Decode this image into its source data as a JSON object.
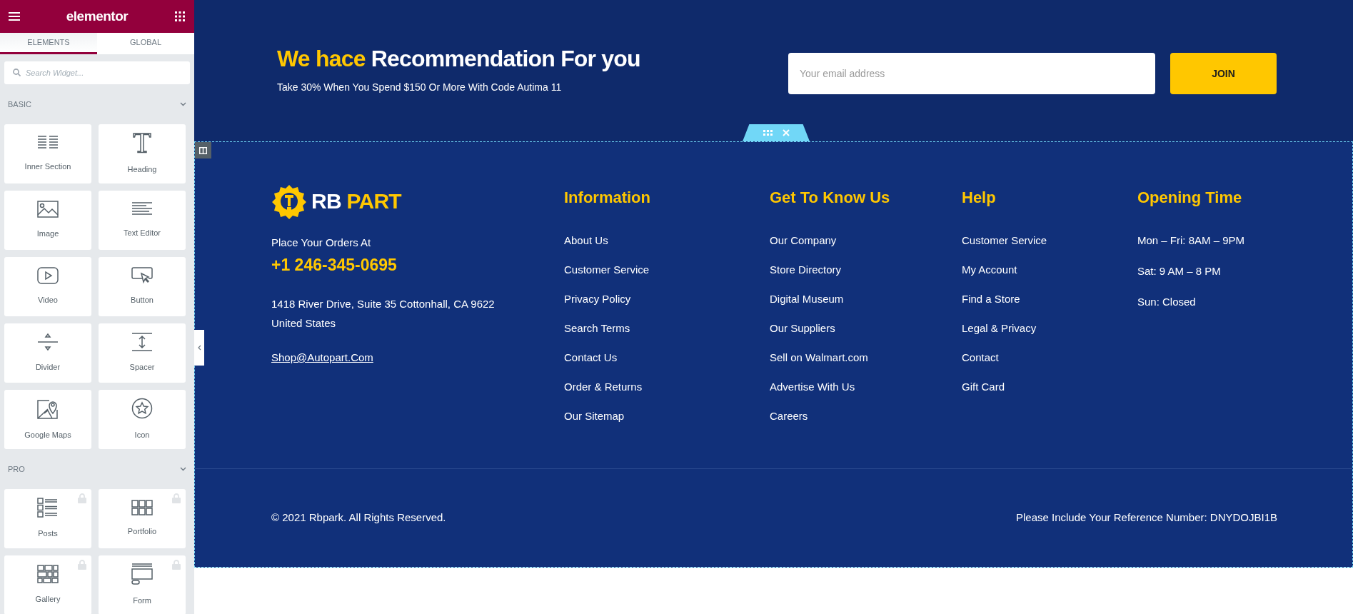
{
  "editor_panel": {
    "title": "elementor",
    "tabs": [
      {
        "label": "ELEMENTS",
        "selected": true
      },
      {
        "label": "GLOBAL",
        "selected": false
      }
    ],
    "search": {
      "placeholder": "Search Widget..."
    },
    "categories": [
      {
        "title": "BASIC",
        "expanded": true,
        "widgets": [
          {
            "label": "Inner Section",
            "locked": false
          },
          {
            "label": "Heading",
            "locked": false
          },
          {
            "label": "Image",
            "locked": false
          },
          {
            "label": "Text Editor",
            "locked": false
          },
          {
            "label": "Video",
            "locked": false
          },
          {
            "label": "Button",
            "locked": false
          },
          {
            "label": "Divider",
            "locked": false
          },
          {
            "label": "Spacer",
            "locked": false
          },
          {
            "label": "Google Maps",
            "locked": false
          },
          {
            "label": "Icon",
            "locked": false
          }
        ]
      },
      {
        "title": "PRO",
        "expanded": true,
        "widgets": [
          {
            "label": "Posts",
            "locked": true
          },
          {
            "label": "Portfolio",
            "locked": true
          },
          {
            "label": "Gallery",
            "locked": true
          },
          {
            "label": "Form",
            "locked": true
          }
        ]
      }
    ]
  },
  "newsletter": {
    "headline_highlight": "We hace",
    "headline_rest": "Recommendation For you",
    "subtitle": "Take 30% When You Spend $150 Or More With Code Autima 11",
    "email": {
      "placeholder": "Your email address"
    },
    "button": "JOIN"
  },
  "footer": {
    "logo": {
      "first": "RB",
      "second": "PART"
    },
    "contact": {
      "label": "Place Your Orders At",
      "phone": "+1 246-345-0695",
      "address_lines": [
        "1418 River Drive, Suite 35 Cottonhall, CA 9622",
        "United States"
      ],
      "email": "Shop@Autopart.Com"
    },
    "columns": [
      {
        "title": "Information",
        "links": [
          "About Us",
          "Customer Service",
          "Privacy Policy",
          "Search Terms",
          "Contact Us",
          "Order & Returns",
          "Our Sitemap"
        ]
      },
      {
        "title": "Get To Know Us",
        "links": [
          "Our Company",
          "Store Directory",
          "Digital Museum",
          "Our Suppliers",
          "Sell on Walmart.com",
          "Advertise With Us",
          "Careers"
        ]
      },
      {
        "title": "Help",
        "links": [
          "Customer Service",
          "My Account",
          "Find a Store",
          "Legal & Privacy",
          "Contact",
          "Gift Card"
        ]
      },
      {
        "title": "Opening Time",
        "links": [
          "Mon – Fri: 8AM – 9PM",
          "Sat: 9 AM – 8 PM",
          "Sun: Closed"
        ]
      }
    ],
    "copyright": "© 2021 Rbpark. All Rights Reserved.",
    "reference": "Please Include Your Reference Number: DNYDOJBI1B"
  }
}
